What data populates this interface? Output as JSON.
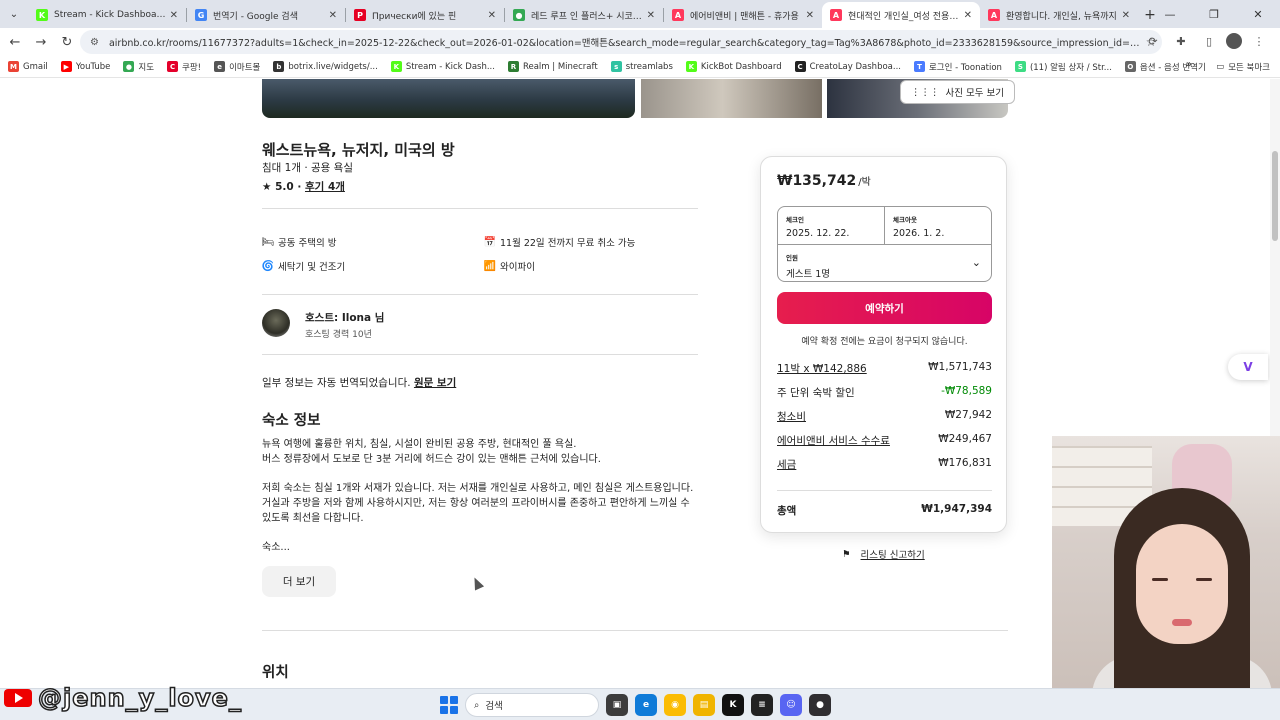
{
  "browser": {
    "tabs": [
      {
        "title": "Stream - Kick Dashboard",
        "color": "#53fc18",
        "glyph": "K",
        "active": false
      },
      {
        "title": "번역기 - Google 검색",
        "color": "#4285f4",
        "glyph": "G",
        "active": false
      },
      {
        "title": "Прически에 있는 핀",
        "color": "#e60023",
        "glyph": "P",
        "active": false
      },
      {
        "title": "레드 루프 인 플러스+ 시코커스",
        "color": "#34a853",
        "glyph": "●",
        "active": false
      },
      {
        "title": "에어비앤비 | 맨해튼 - 휴가용",
        "color": "#ff385c",
        "glyph": "A",
        "active": false
      },
      {
        "title": "현대적인 개인실_여성 전용 - 에",
        "color": "#ff385c",
        "glyph": "A",
        "active": true
      },
      {
        "title": "환영합니다. 개인실, 뉴욕까지",
        "color": "#ff385c",
        "glyph": "A",
        "active": false
      }
    ],
    "url": "airbnb.co.kr/rooms/11677372?adults=1&check_in=2025-12-22&check_out=2026-01-02&location=맨해튼&search_mode=regular_search&category_tag=Tag%3A8678&photo_id=2333628159&source_impression_id=p3_1758405181_P314E2ci3...",
    "bookmarks": [
      {
        "label": "Gmail",
        "color": "#ea4335",
        "glyph": "M"
      },
      {
        "label": "YouTube",
        "color": "#ff0000",
        "glyph": "▶"
      },
      {
        "label": "지도",
        "color": "#34a853",
        "glyph": "●"
      },
      {
        "label": "쿠팡!",
        "color": "#e4002b",
        "glyph": "C"
      },
      {
        "label": "이마트몰",
        "color": "#555555",
        "glyph": "e"
      },
      {
        "label": "botrix.live/widgets/...",
        "color": "#333333",
        "glyph": "b"
      },
      {
        "label": "Stream - Kick Dash...",
        "color": "#53fc18",
        "glyph": "K"
      },
      {
        "label": "Realm | Minecraft",
        "color": "#2e7d32",
        "glyph": "R"
      },
      {
        "label": "streamlabs",
        "color": "#31c3a2",
        "glyph": "s"
      },
      {
        "label": "KickBot Dashboard",
        "color": "#53fc18",
        "glyph": "K"
      },
      {
        "label": "CreatoLay Dashboa...",
        "color": "#222222",
        "glyph": "C"
      },
      {
        "label": "로그인 - Toonation",
        "color": "#4a7bff",
        "glyph": "T"
      },
      {
        "label": "(11) 알림 상자 / Str...",
        "color": "#3ddc84",
        "glyph": "S"
      },
      {
        "label": "옵션 - 음성 번역기",
        "color": "#666666",
        "glyph": "O"
      }
    ],
    "bookmarks_folder": "모든 북마크"
  },
  "listing": {
    "show_all_photos": "사진 모두 보기",
    "title": "웨스트뉴욕, 뉴저지, 미국의 방",
    "subtitle": "침대 1개 · 공용 욕실",
    "rating_score": "★ 5.0 · ",
    "reviews_link": "후기 4개",
    "amenities": [
      {
        "icon": "🛏",
        "label": "공동 주택의 방"
      },
      {
        "icon": "📅",
        "label": "11월 22일 전까지 무료 취소 가능"
      },
      {
        "icon": "🌀",
        "label": "세탁기 및 건조기"
      },
      {
        "icon": "📶",
        "label": "와이파이"
      }
    ],
    "host_name": "호스트: Ilona 님",
    "host_years": "호스팅 경력 10년",
    "translation_note": "일부 정보는 자동 번역되었습니다. ",
    "translation_link": "원문 보기",
    "about_title": "숙소 정보",
    "about_p1": "뉴욕 여행에 훌륭한 위치, 침실, 시설이 완비된 공용 주방, 현대적인 풀 욕실.",
    "about_p2": "버스 정류장에서 도보로 단 3분 거리에 허드슨 강이 있는 맨해튼 근처에 있습니다.",
    "about_p3": "저희 숙소는 침실 1개와 서재가 있습니다. 저는 서재를 개인실로 사용하고, 메인 침실은 게스트용입니다. 거실과 주방을 저와 함께 사용하시지만, 저는 항상 여러분의 프라이버시를 존중하고 편안하게 느끼실 수 있도록 최선을 다합니다.",
    "about_p4": "숙소...",
    "more_button": "더 보기",
    "location_title": "위치"
  },
  "booking": {
    "price": "₩135,742",
    "per_night": "/박",
    "checkin_label": "체크인",
    "checkin_value": "2025. 12. 22.",
    "checkout_label": "체크아웃",
    "checkout_value": "2026. 1. 2.",
    "guests_label": "인원",
    "guests_value": "게스트 1명",
    "reserve_button": "예약하기",
    "notice": "예약 확정 전에는 요금이 청구되지 않습니다.",
    "lines": [
      {
        "label": "11박 x ₩142,886",
        "amount": "₩1,571,743",
        "underline": true,
        "discount": false
      },
      {
        "label": "주 단위 숙박 할인",
        "amount": "-₩78,589",
        "underline": false,
        "discount": true
      },
      {
        "label": "청소비",
        "amount": "₩27,942",
        "underline": true,
        "discount": false
      },
      {
        "label": "에어비앤비 서비스 수수료",
        "amount": "₩249,467",
        "underline": true,
        "discount": false
      },
      {
        "label": "세금",
        "amount": "₩176,831",
        "underline": true,
        "discount": false
      }
    ],
    "total_label": "총액",
    "total_value": "₩1,947,394",
    "report_link": "리스팅 신고하기"
  },
  "overlay": {
    "channel_handle": "@jenn_y_love_"
  },
  "taskbar": {
    "search_placeholder": "검색"
  }
}
